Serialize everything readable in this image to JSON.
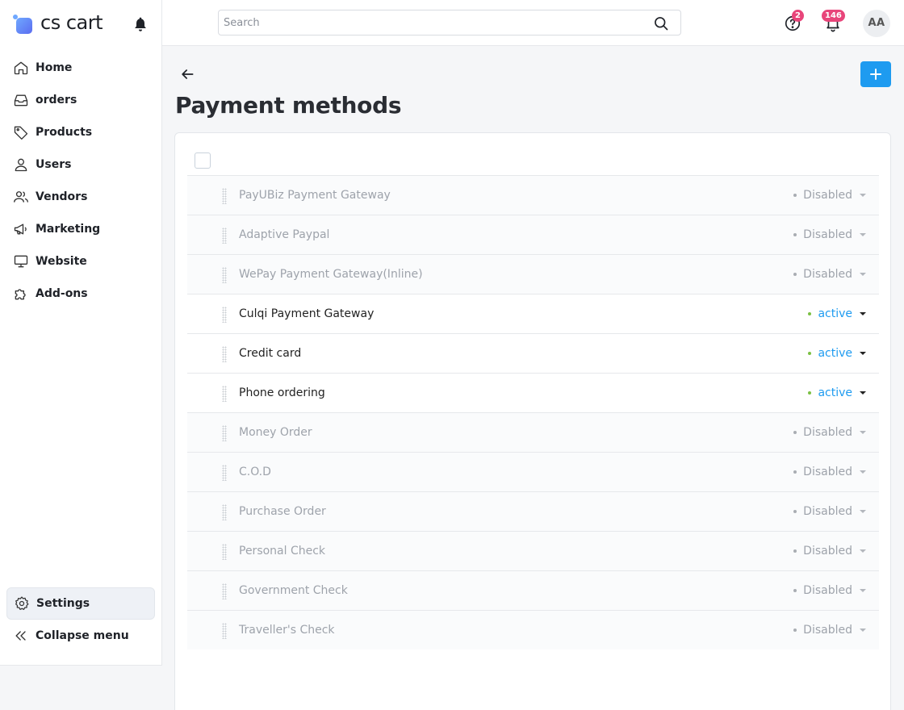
{
  "logo": {
    "text": "cs cart"
  },
  "sidebar": {
    "items": [
      {
        "label": "Home",
        "icon": "home-icon"
      },
      {
        "label": "orders",
        "icon": "inbox-icon"
      },
      {
        "label": "Products",
        "icon": "tag-icon"
      },
      {
        "label": "Users",
        "icon": "user-icon"
      },
      {
        "label": "Vendors",
        "icon": "users-icon"
      },
      {
        "label": "Marketing",
        "icon": "megaphone-icon"
      },
      {
        "label": "Website",
        "icon": "monitor-icon"
      },
      {
        "label": "Add-ons",
        "icon": "puzzle-icon"
      }
    ],
    "settings_label": "Settings",
    "collapse_label": "Collapse menu"
  },
  "header": {
    "search_placeholder": "Search",
    "help_badge": "2",
    "notifications_badge": "146",
    "avatar_initials": "AA"
  },
  "page": {
    "title": "Payment methods"
  },
  "payment_methods": [
    {
      "name": "PayUBiz Payment Gateway",
      "status": "Disabled"
    },
    {
      "name": "Adaptive Paypal",
      "status": "Disabled"
    },
    {
      "name": "WePay Payment Gateway(Inline)",
      "status": "Disabled"
    },
    {
      "name": "Culqi Payment Gateway",
      "status": "active"
    },
    {
      "name": "Credit card",
      "status": "active"
    },
    {
      "name": "Phone ordering",
      "status": "active"
    },
    {
      "name": "Money Order",
      "status": "Disabled"
    },
    {
      "name": "C.O.D",
      "status": "Disabled"
    },
    {
      "name": "Purchase Order",
      "status": "Disabled"
    },
    {
      "name": "Personal Check",
      "status": "Disabled"
    },
    {
      "name": "Government Check",
      "status": "Disabled"
    },
    {
      "name": "Traveller's Check",
      "status": "Disabled"
    }
  ],
  "colors": {
    "accent": "#1e9bf0",
    "active_dot": "#7bc043",
    "badge": "#e8457a"
  }
}
